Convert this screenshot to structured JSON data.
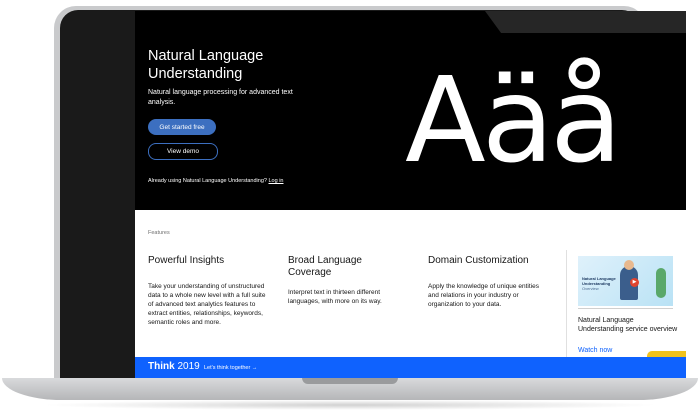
{
  "hero": {
    "title": "Natural Language Understanding",
    "subtitle": "Natural language processing for advanced text analysis.",
    "primary_button": "Get started free",
    "secondary_button": "View demo",
    "login_prefix": "Already using Natural Language Understanding?",
    "login_link": "Log in",
    "glyph_text": "Aäå"
  },
  "features": {
    "label": "Features",
    "items": [
      {
        "title": "Powerful Insights",
        "body": "Take your understanding of unstructured data to a whole new level with a full suite of advanced text analytics features to extract entities, relationships, keywords, semantic roles and more."
      },
      {
        "title": "Broad Language Coverage",
        "body": "Interpret text in thirteen different languages, with more on its way."
      },
      {
        "title": "Domain Customization",
        "body": "Apply the knowledge of unique entities and relations in your industry or organization to your data."
      }
    ]
  },
  "video_card": {
    "thumb_title": "Natural Language Understanding",
    "thumb_sub": "Overview",
    "title": "Natural Language Understanding service overview",
    "link": "Watch now"
  },
  "think_banner": {
    "brand_bold": "Think",
    "brand_year": "2019",
    "link": "Let's think together →"
  },
  "colors": {
    "hero_bg": "#000000",
    "primary": "#3c6fc0",
    "banner": "#0f62fe",
    "tab": "#f1c21b"
  },
  "icons": [
    "play-icon"
  ]
}
